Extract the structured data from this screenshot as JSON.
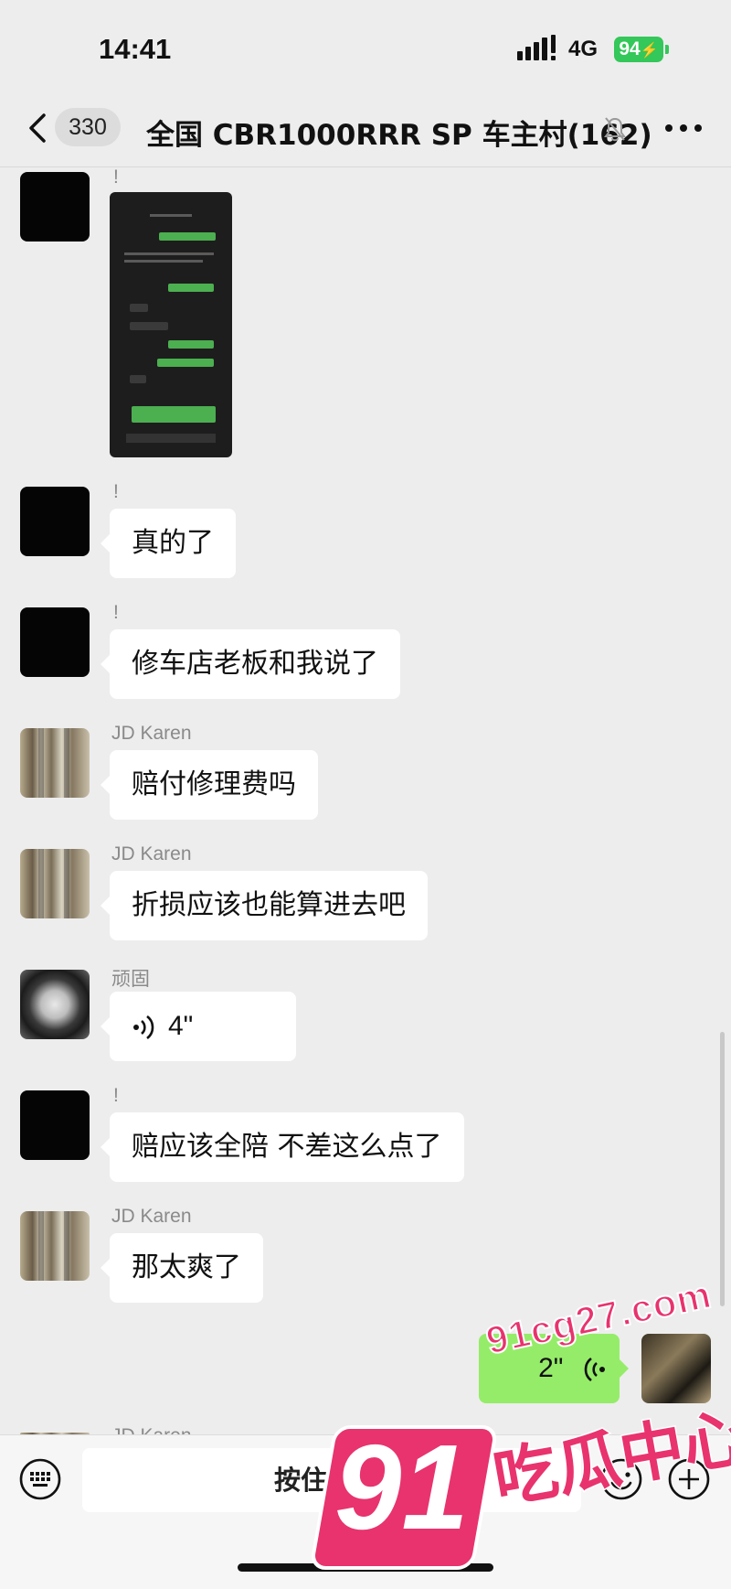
{
  "status_bar": {
    "time": "14:41",
    "network": "4G",
    "battery": "94"
  },
  "header": {
    "unread_count": "330",
    "title": "全国 CBR1000RRR SP 车主村(162)"
  },
  "messages": [
    {
      "sender": "!",
      "type": "image"
    },
    {
      "sender": "!",
      "text": "真的了"
    },
    {
      "sender": "!",
      "text": "修车店老板和我说了"
    },
    {
      "sender": "JD Karen",
      "text": "赔付修理费吗"
    },
    {
      "sender": "JD Karen",
      "text": "折损应该也能算进去吧"
    },
    {
      "sender": "顽固",
      "type": "voice",
      "duration": "4\""
    },
    {
      "sender": "!",
      "text": "赔应该全陪 不差这么点了"
    },
    {
      "sender": "JD Karen",
      "text": "那太爽了"
    },
    {
      "sender": "me",
      "type": "voice",
      "duration": "2\""
    }
  ],
  "partial_sender": "JD Karen",
  "input_bar": {
    "hold_to_talk": "按住 说话"
  },
  "watermark": {
    "url": "91cg27.com",
    "number": "91",
    "name": "吃瓜中心"
  },
  "colors": {
    "my_bubble": "#95ec69",
    "battery": "#34c759",
    "watermark": "#e8336e"
  }
}
